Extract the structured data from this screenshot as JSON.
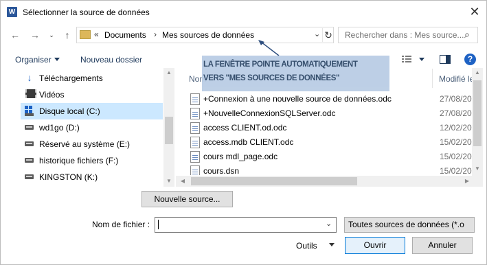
{
  "window": {
    "app_icon_letter": "W",
    "title": "Sélectionner la source de données",
    "close_glyph": "✕"
  },
  "navigation": {
    "back_glyph": "←",
    "forward_glyph": "→",
    "up_glyph": "↑",
    "address_prefix": "«",
    "breadcrumbs": [
      "Documents",
      "Mes sources de données"
    ],
    "breadcrumb_separator": "›",
    "address_dropdown_glyph": "⌄",
    "refresh_glyph": "↻",
    "search_placeholder": "Rechercher dans : Mes source...",
    "search_icon_glyph": "⌕"
  },
  "toolbar": {
    "organize_label": "Organiser",
    "new_folder_label": "Nouveau dossier",
    "help_glyph": "?"
  },
  "sidebar": {
    "items": [
      {
        "label": "Téléchargements",
        "icon": "download-icon",
        "selected": false
      },
      {
        "label": "Vidéos",
        "icon": "video-icon",
        "selected": false
      },
      {
        "label": "Disque local (C:)",
        "icon": "system-drive-icon",
        "selected": true
      },
      {
        "label": "wd1go (D:)",
        "icon": "drive-icon",
        "selected": false
      },
      {
        "label": "Réservé au système (E:)",
        "icon": "drive-icon",
        "selected": false
      },
      {
        "label": "historique fichiers (F:)",
        "icon": "drive-icon",
        "selected": false
      },
      {
        "label": "KINGSTON (K:)",
        "icon": "drive-icon",
        "selected": false
      }
    ]
  },
  "file_list": {
    "columns": {
      "name": "Nom",
      "modified": "Modifié le"
    },
    "rows": [
      {
        "name": "+Connexion à une nouvelle source de données.odc",
        "date": "27/08/2016"
      },
      {
        "name": "+NouvelleConnexionSQLServer.odc",
        "date": "27/08/2016"
      },
      {
        "name": "access CLIENT.od.odc",
        "date": "12/02/2016"
      },
      {
        "name": "access.mdb CLIENT.odc",
        "date": "15/02/2016"
      },
      {
        "name": "cours mdl_page.odc",
        "date": "15/02/2016"
      },
      {
        "name": "cours.dsn",
        "date": "15/02/2016"
      }
    ]
  },
  "annotation": {
    "text": "LA FENÊTRE POINTE AUTOMATIQUEMENT\nVERS \"MES SOURCES DE DONNÉES\""
  },
  "actions": {
    "new_source_label": "Nouvelle source...",
    "filename_label": "Nom de fichier :",
    "filename_value": "",
    "filetype_value": "Toutes sources de données (*.o",
    "tools_label": "Outils",
    "open_label": "Ouvrir",
    "cancel_label": "Annuler"
  },
  "colors": {
    "selection": "#cce8ff",
    "accent": "#0078d7",
    "annotation_bg": "#b8cce4",
    "annotation_text": "#243f60"
  }
}
